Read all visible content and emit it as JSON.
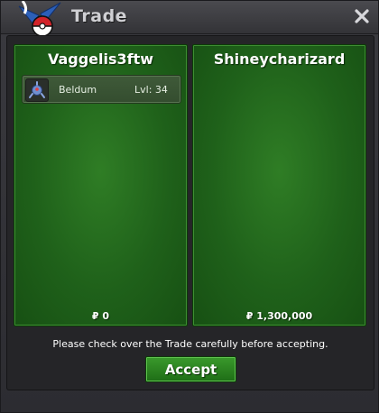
{
  "window": {
    "title": "Trade",
    "logo_icon": "pokeball-logo-icon",
    "close_icon": "close-icon"
  },
  "left_player": {
    "name": "Vaggelis3ftw",
    "items": [
      {
        "icon": "beldum-icon",
        "name": "Beldum",
        "level": "Lvl: 34"
      }
    ],
    "money": "₽ 0"
  },
  "right_player": {
    "name": "Shineycharizard",
    "items": [],
    "money": "₽ 1,300,000"
  },
  "notice": "Please check over the Trade carefully before accepting.",
  "accept_label": "Accept",
  "colors": {
    "panel_green": "#1f611a",
    "accept_green": "#2a8420",
    "title_text": "#cfcfd3"
  }
}
